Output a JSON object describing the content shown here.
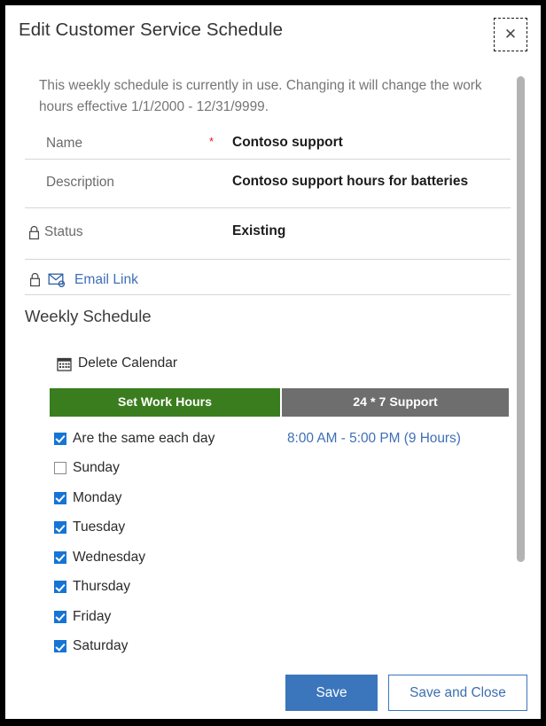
{
  "dialog": {
    "title": "Edit Customer Service Schedule",
    "close_icon": "close-icon",
    "info_text": "This weekly schedule is currently in use. Changing it will change the work hours effective 1/1/2000 - 12/31/9999."
  },
  "fields": [
    {
      "label": "Name",
      "required_marker": "*",
      "value": "Contoso support",
      "locked": false
    },
    {
      "label": "Description",
      "required_marker": "",
      "value": "Contoso support hours for batteries",
      "locked": false
    },
    {
      "label": "Status",
      "required_marker": "",
      "value": "Existing",
      "locked": true
    }
  ],
  "email_link": {
    "label": "Email Link",
    "locked": true,
    "icon": "email-link-icon"
  },
  "weekly_schedule": {
    "section_title": "Weekly Schedule",
    "delete_calendar": {
      "label": "Delete Calendar",
      "icon": "calendar-icon"
    },
    "tabs": [
      {
        "label": "Set Work Hours",
        "selected": true,
        "color": "#3a7d1e"
      },
      {
        "label": "24 * 7 Support",
        "selected": false,
        "color": "#6e6e6e"
      }
    ],
    "rows": [
      {
        "label": "Are the same each day",
        "checked": true,
        "time": "8:00 AM - 5:00 PM (9 Hours)"
      },
      {
        "label": "Sunday",
        "checked": false,
        "time": ""
      },
      {
        "label": "Monday",
        "checked": true,
        "time": ""
      },
      {
        "label": "Tuesday",
        "checked": true,
        "time": ""
      },
      {
        "label": "Wednesday",
        "checked": true,
        "time": ""
      },
      {
        "label": "Thursday",
        "checked": true,
        "time": ""
      },
      {
        "label": "Friday",
        "checked": true,
        "time": ""
      },
      {
        "label": "Saturday",
        "checked": true,
        "time": ""
      }
    ]
  },
  "footer": {
    "save_label": "Save",
    "save_and_close_label": "Save and Close"
  },
  "colors": {
    "accent_blue": "#3b76bc",
    "link_blue": "#3f6fb5",
    "tab_green": "#3a7d1e",
    "tab_gray": "#6e6e6e",
    "required_red": "#e81123",
    "checkbox_blue": "#1674d4"
  }
}
